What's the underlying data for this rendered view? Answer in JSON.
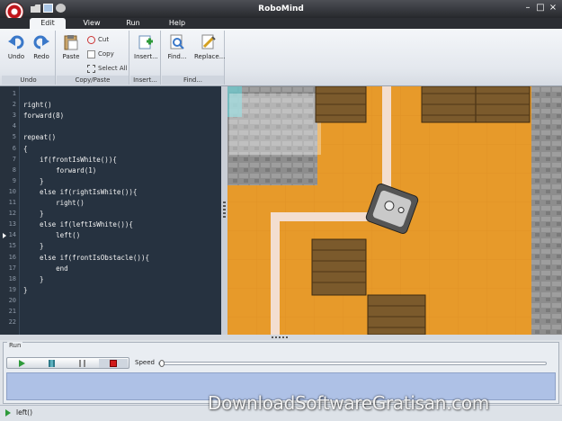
{
  "window": {
    "title": "RoboMind"
  },
  "tabs": [
    "Edit",
    "View",
    "Run",
    "Help"
  ],
  "ribbon": {
    "undo": {
      "label": "Undo",
      "group": "Undo"
    },
    "redo": {
      "label": "Redo"
    },
    "paste": {
      "label": "Paste",
      "group": "Copy/Paste"
    },
    "cut": "Cut",
    "copy": "Copy",
    "select_all": "Select All",
    "insert": {
      "label": "Insert...",
      "group": "Insert..."
    },
    "find": {
      "label": "Find...",
      "group": "Find..."
    },
    "replace": {
      "label": "Replace..."
    }
  },
  "editor": {
    "line_numbers": [
      "1",
      "2",
      "3",
      "4",
      "5",
      "6",
      "7",
      "8",
      "9",
      "10",
      "11",
      "12",
      "13",
      "14",
      "15",
      "16",
      "17",
      "18",
      "19",
      "20",
      "21",
      "22"
    ],
    "lines": [
      "",
      "right()",
      "forward(8)",
      "",
      "repeat()",
      "{",
      "    if(frontIsWhite()){",
      "        forward(1)",
      "    }",
      "    else if(rightIsWhite()){",
      "        right()",
      "    }",
      "    else if(leftIsWhite()){",
      "        left()",
      "    }",
      "    else if(frontIsObstacle()){",
      "        end",
      "    }",
      "}",
      "",
      "",
      ""
    ]
  },
  "run_panel": {
    "title": "Run",
    "speed_label": "Speed",
    "speed_fraction": 0.0,
    "controls": [
      "play-icon",
      "step-icon",
      "pause-icon",
      "stop-icon"
    ]
  },
  "status": {
    "text": "left()"
  },
  "watermark": "DownloadSoftwareGratisan.com",
  "colors": {
    "editor_bg": "#263240",
    "sand": "#e79a2a",
    "path": "#f3ded0",
    "output_bg": "#aec1e6"
  }
}
